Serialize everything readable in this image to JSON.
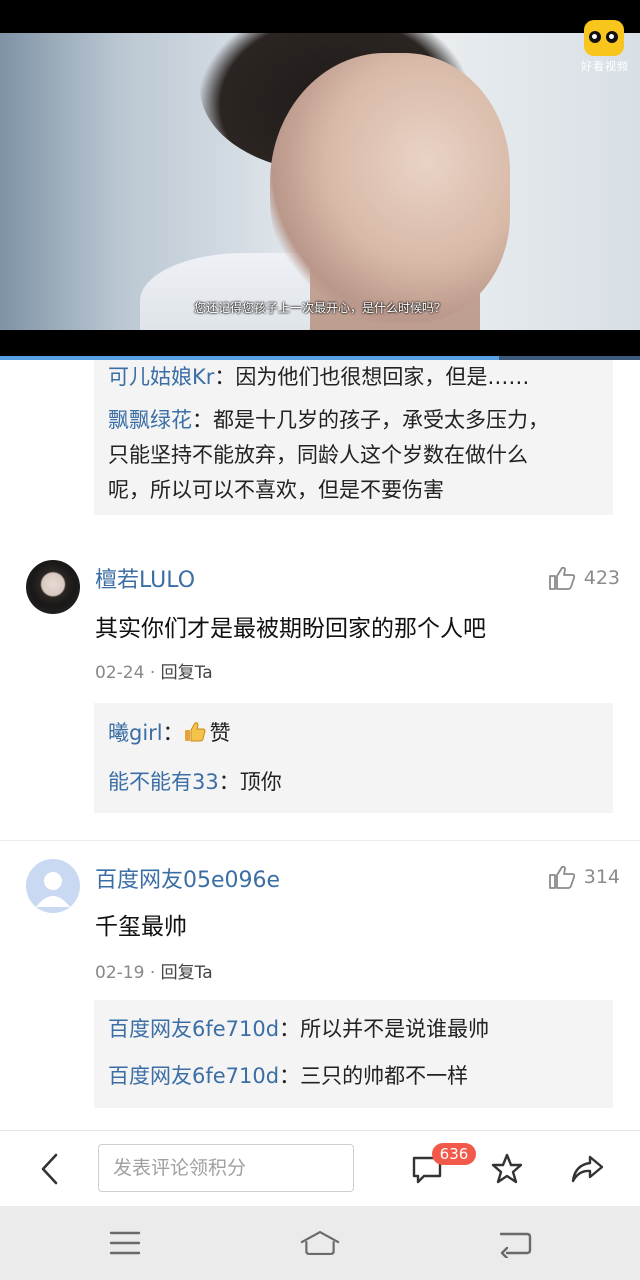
{
  "video": {
    "subtitle": "您还记得您孩子上一次最开心，是什么时候吗？",
    "logo_text": "好看视频",
    "progress": 0.78
  },
  "top_replies": [
    {
      "user": "可儿姑娘Kr",
      "sep": "：",
      "text": "因为他们也很想回家，但是……"
    },
    {
      "user": "飘飘绿花",
      "sep": "：",
      "text": "都是十几岁的孩子，承受太多压力，"
    },
    {
      "line": "只能坚持不能放弃，同龄人这个岁数在做什么"
    },
    {
      "line": "呢，所以可以不喜欢，但是不要伤害"
    }
  ],
  "comments": [
    {
      "user": "檀若LULO",
      "likes": "423",
      "text": "其实你们才是最被期盼回家的那个人吧",
      "date": "02-24",
      "dot": "·",
      "reply_label": "回复Ta",
      "replies": [
        {
          "user": "曦girl",
          "sep": "：",
          "text": "赞"
        },
        {
          "user": "能不能有33",
          "sep": "：",
          "text": "顶你"
        }
      ]
    },
    {
      "user": "百度网友05e096e",
      "likes": "314",
      "text": "千玺最帅",
      "date": "02-19",
      "dot": "·",
      "reply_label": "回复Ta",
      "replies": [
        {
          "user": "百度网友6fe710d",
          "sep": "：",
          "text": "所以并不是说谁最帅"
        },
        {
          "user": "百度网友6fe710d",
          "sep": "：",
          "text": "三只的帅都不一样"
        }
      ]
    }
  ],
  "bottom_bar": {
    "input_placeholder": "发表评论领积分",
    "comment_count": "636"
  },
  "icons": {
    "back": "chevron-left-icon",
    "comments": "comment-icon",
    "favorite": "star-icon",
    "share": "share-icon",
    "like": "thumbs-up-icon",
    "thumbs_emoji": "thumbs-up-emoji",
    "menu": "menu-icon",
    "home": "home-icon",
    "nav_back": "return-icon"
  },
  "colors": {
    "username": "#3b6ea5",
    "badge": "#f15a4a",
    "reply_bg": "#f4f4f5"
  }
}
